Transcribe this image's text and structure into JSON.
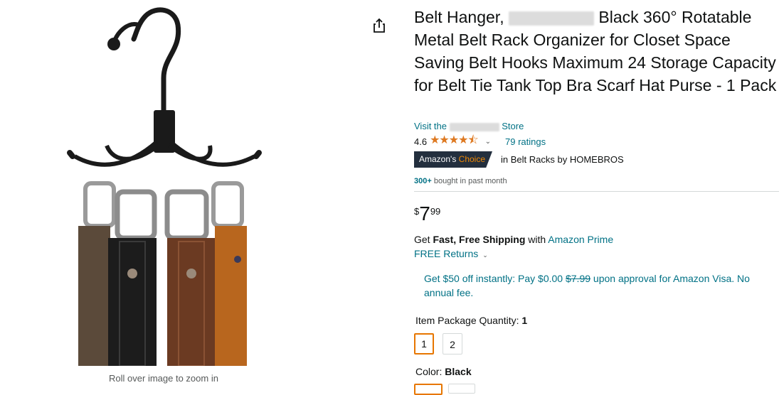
{
  "media": {
    "zoom_hint": "Roll over image to zoom in",
    "share_icon": "share-icon"
  },
  "product": {
    "title_prefix": "Belt Hanger,",
    "title_rest": "Black 360° Rotatable Metal Belt Rack Organizer for Closet Space Saving Belt Hooks Maximum 24 Storage Capacity for Belt Tie Tank Top Bra Scarf Hat Purse - 1 Pack",
    "store_prefix": "Visit the",
    "store_suffix": "Store",
    "rating_value": "4.6",
    "rating_stars": 4.6,
    "ratings_count": "79 ratings",
    "choice_badge_a": "Amazon's",
    "choice_badge_b": "Choice",
    "choice_category": "in Belt Racks by HOMEBROS",
    "bought_count": "300+",
    "bought_text": "bought in past month"
  },
  "price": {
    "symbol": "$",
    "whole": "7",
    "fraction": "99"
  },
  "shipping": {
    "get": "Get",
    "fast_free": "Fast, Free Shipping",
    "with": "with",
    "prime_link": "Amazon Prime",
    "returns": "FREE Returns"
  },
  "offer": {
    "text_a": "Get $50 off instantly: Pay $0.00",
    "strike": "$7.99",
    "text_b": "upon approval for Amazon Visa. No annual fee."
  },
  "quantity": {
    "label": "Item Package Quantity:",
    "selected": "1",
    "options": [
      "1",
      "2"
    ]
  },
  "color": {
    "label": "Color:",
    "selected": "Black"
  },
  "colors": {
    "link": "#007185",
    "star": "#de7921",
    "badge_bg": "#232f3e",
    "badge_accent": "#f08804",
    "selected_border": "#e77600"
  }
}
